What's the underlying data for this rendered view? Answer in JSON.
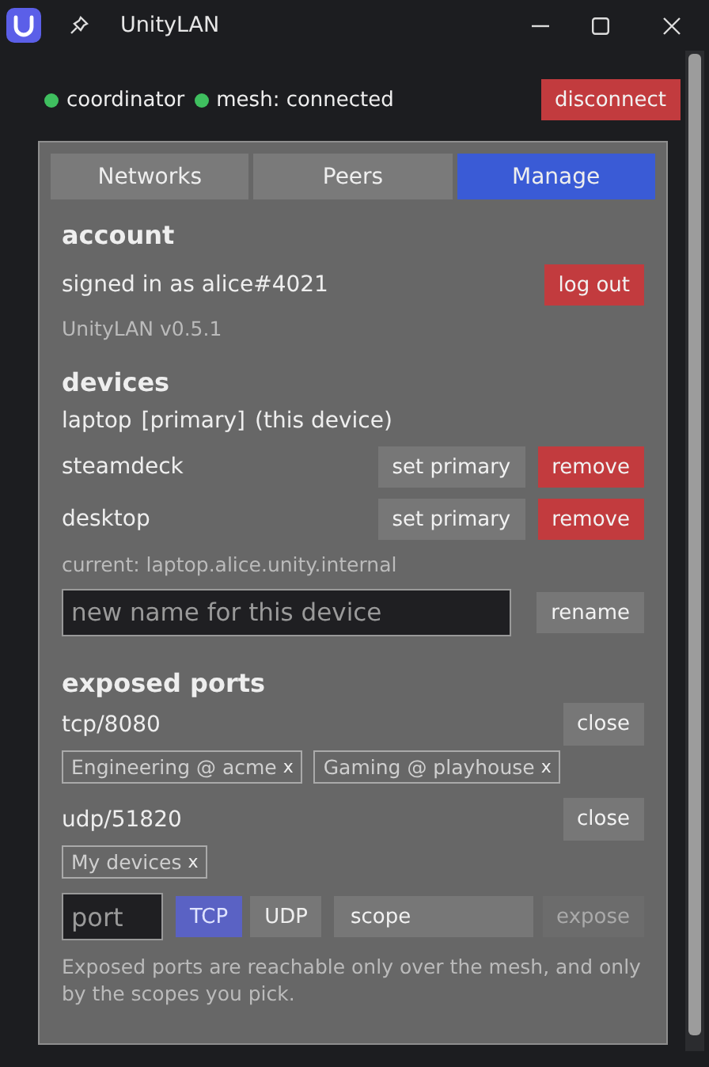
{
  "window": {
    "title": "UnityLAN"
  },
  "status": {
    "indicators": [
      {
        "label": "coordinator",
        "color": "#3fbf5f"
      },
      {
        "label": "mesh: connected",
        "color": "#3fbf5f"
      }
    ],
    "disconnect": "disconnect"
  },
  "tabs": [
    {
      "label": "Networks",
      "selected": false
    },
    {
      "label": "Peers",
      "selected": false
    },
    {
      "label": "Manage",
      "selected": true
    }
  ],
  "account": {
    "heading": "account",
    "signed_in": "signed in as alice#4021",
    "logout": "log out",
    "version": "UnityLAN v0.5.1"
  },
  "devices": {
    "heading": "devices",
    "items": [
      {
        "name": "laptop",
        "labels": [
          "[primary]",
          "(this device)"
        ]
      },
      {
        "name": "steamdeck",
        "actions": [
          {
            "label": "set primary",
            "kind": "neutral"
          },
          {
            "label": "remove",
            "kind": "danger"
          }
        ]
      },
      {
        "name": "desktop",
        "actions": [
          {
            "label": "set primary",
            "kind": "neutral"
          },
          {
            "label": "remove",
            "kind": "danger"
          }
        ]
      }
    ],
    "current": "current: laptop.alice.unity.internal",
    "rename": {
      "placeholder": "new name for this device",
      "button": "rename"
    }
  },
  "ports": {
    "heading": "exposed ports",
    "items": [
      {
        "name": "tcp/8080",
        "close": "close",
        "scopes": [
          {
            "label": "Engineering @ acme",
            "remove": "x"
          },
          {
            "label": "Gaming @ playhouse",
            "remove": "x"
          }
        ]
      },
      {
        "name": "udp/51820",
        "close": "close",
        "scopes": [
          {
            "label": "My devices",
            "remove": "x"
          }
        ]
      }
    ],
    "new_port": {
      "placeholder": "port",
      "protocols": [
        {
          "label": "TCP",
          "selected": true
        },
        {
          "label": "UDP",
          "selected": false
        }
      ],
      "scope": "scope",
      "expose": {
        "label": "expose",
        "disabled": true
      }
    },
    "note": "Exposed ports are reachable only over the mesh, and only by the scopes you pick."
  }
}
